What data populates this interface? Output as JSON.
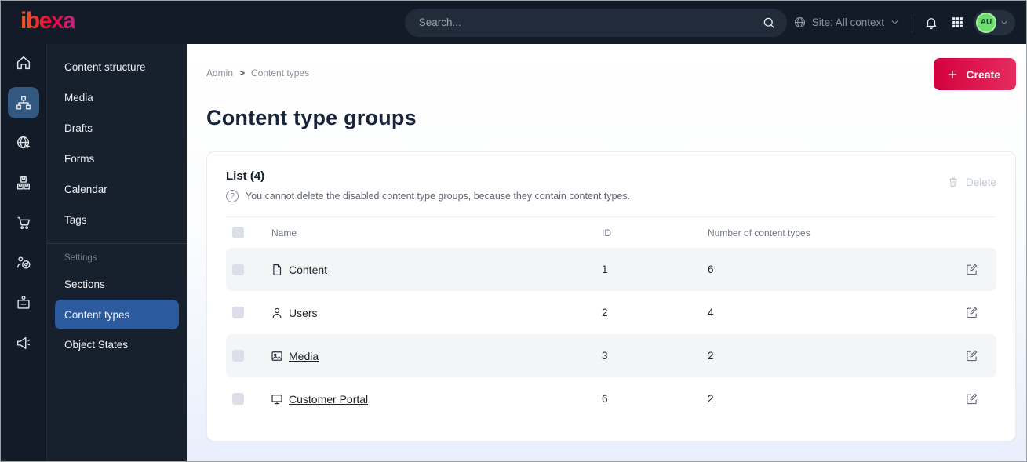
{
  "topbar": {
    "logo_text": "ibexa",
    "search_placeholder": "Search...",
    "site_context_label": "Site: All context",
    "avatar_initials": "AU"
  },
  "rail": {
    "items": [
      {
        "icon": "home-icon",
        "active": false
      },
      {
        "icon": "content-structure-icon",
        "active": true
      },
      {
        "icon": "site-globe-icon",
        "active": false
      },
      {
        "icon": "products-boxes-icon",
        "active": false
      },
      {
        "icon": "commerce-cart-icon",
        "active": false
      },
      {
        "icon": "marketing-target-icon",
        "active": false
      },
      {
        "icon": "personalization-badge-icon",
        "active": false
      },
      {
        "icon": "campaign-megaphone-icon",
        "active": false
      }
    ]
  },
  "menu": {
    "items": [
      "Content structure",
      "Media",
      "Drafts",
      "Forms",
      "Calendar",
      "Tags"
    ],
    "settings_label": "Settings",
    "settings_items": [
      "Sections",
      "Content types",
      "Object States"
    ],
    "active_item": "Content types"
  },
  "breadcrumb": {
    "items": [
      "Admin",
      "Content types"
    ],
    "separator": ">"
  },
  "page": {
    "title": "Content type groups",
    "create_label": "Create"
  },
  "panel": {
    "list_title": "List (4)",
    "info_text": "You cannot delete the disabled content type groups, because they contain content types.",
    "delete_label": "Delete"
  },
  "table": {
    "headers": {
      "name": "Name",
      "id": "ID",
      "count": "Number of content types"
    },
    "rows": [
      {
        "icon": "file-icon",
        "name": "Content",
        "id": "1",
        "count": "6"
      },
      {
        "icon": "user-icon",
        "name": "Users",
        "id": "2",
        "count": "4"
      },
      {
        "icon": "image-icon",
        "name": "Media",
        "id": "3",
        "count": "2"
      },
      {
        "icon": "monitor-icon",
        "name": "Customer Portal",
        "id": "6",
        "count": "2"
      }
    ]
  },
  "colors": {
    "topbar_bg": "#141b28",
    "active_blue": "#2c5a9e",
    "accent_gradient_start": "#d2023e",
    "accent_gradient_end": "#e62c5e",
    "avatar_green": "#6fdd6f",
    "zebra_row": "#f4f5f7"
  }
}
